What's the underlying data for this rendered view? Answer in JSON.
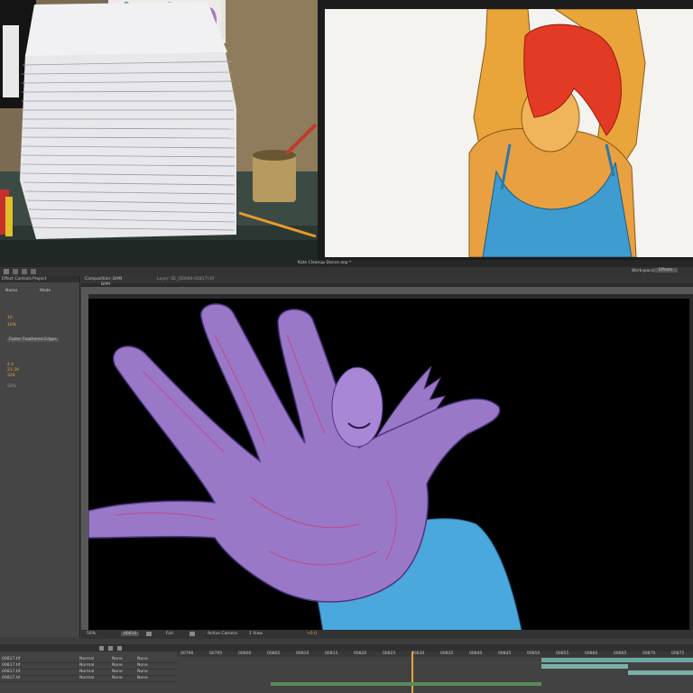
{
  "window": {
    "title": "Kate Cleanup Dance.aep *",
    "workspace_label": "Workspace:",
    "workspace_value": "Effects"
  },
  "project_panel": {
    "tab_label": "Project",
    "effects_label": "Effect Controls",
    "column_name": "Name",
    "column_mode": "Mode",
    "values": [
      "10",
      "10%",
      "4.0",
      "21.59",
      "326",
      "50%"
    ],
    "effect_dropdown": "Faster Feathered Edges"
  },
  "composition": {
    "tab_label": "Composition: BAM",
    "layer_tab_label": "Layer: SE_[00000-01817].tif",
    "subtab_label": "BAM"
  },
  "viewer_bar": {
    "zoom": "50%",
    "timecode": "00810",
    "resolution": "Full",
    "camera": "Active Camera",
    "view": "1 View",
    "offset": "+0.0"
  },
  "timeline": {
    "rows": [
      {
        "name": "00817.tif",
        "mode": "Normal",
        "trkmat": "None",
        "parent": "None"
      },
      {
        "name": "00817.tif",
        "mode": "Normal",
        "trkmat": "None",
        "parent": "None"
      },
      {
        "name": "00817.tif",
        "mode": "Normal",
        "trkmat": "None",
        "parent": "None"
      },
      {
        "name": "00817.tif",
        "mode": "Normal",
        "trkmat": "None",
        "parent": "None"
      }
    ],
    "ruler_labels": [
      "00790",
      "00795",
      "00800",
      "00805",
      "00810",
      "00815",
      "00820",
      "00825",
      "00830",
      "00835",
      "00840",
      "00845",
      "00850",
      "00855",
      "00860",
      "00865",
      "00870",
      "00875"
    ]
  },
  "colors": {
    "accent_orange": "#e3a63a",
    "panel_bg": "#3d3d3d",
    "viewer_bg": "#000000",
    "hand_violet": "#9a78c8",
    "shirt_blue": "#48a6dc"
  },
  "icons": [
    "play-icon",
    "camera-icon",
    "grid-icon",
    "eye-icon",
    "lock-icon"
  ]
}
